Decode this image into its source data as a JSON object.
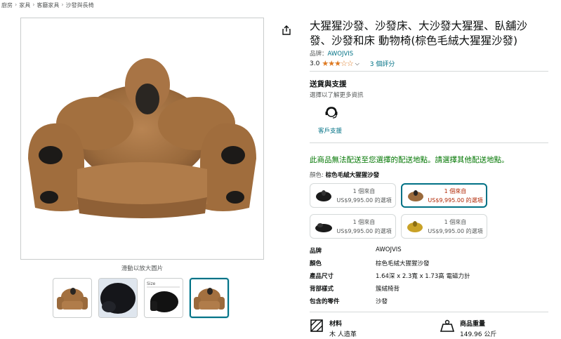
{
  "breadcrumb": [
    "廚房",
    "家具",
    "客廳家具",
    "沙發與長椅"
  ],
  "product": {
    "title": "大猩猩沙發、沙發床、大沙發大猩猩、臥舖沙發、沙發和床 動物椅(棕色毛絨大猩猩沙發)",
    "brand_prefix": "品牌：",
    "brand": "AWOJVIS",
    "rating_value": "3.0",
    "rating": 3.0,
    "rating_max": 5,
    "rating_count": "3 個評分"
  },
  "gallery": {
    "zoom_hint": "滑動以放大圖片",
    "thumbnail_count": 4,
    "thumbnail_size_label": "Size",
    "active_index": 3
  },
  "delivery": {
    "title": "送貨與支援",
    "subtitle": "選擇以了解更多資訊",
    "support_label": "客戶支援",
    "warning": "此商品無法配送至您選擇的配送地點。請選擇其他配送地點。"
  },
  "variant": {
    "label": "顏色:",
    "selected": "棕色毛絨大猩猩沙發",
    "options": [
      {
        "line1": "1 個來自",
        "line2": "US$9,995.00 的選項",
        "selected": false,
        "color": "#1a1a1a"
      },
      {
        "line1": "1 個來自",
        "line2": "US$9,995.00 的選項",
        "selected": true,
        "color": "#9a6a3c"
      },
      {
        "line1": "1 個來自",
        "line2": "US$9,995.00 的選項",
        "selected": false,
        "color": "#1a1a1a"
      },
      {
        "line1": "1 個來自",
        "line2": "US$9,995.00 的選項",
        "selected": false,
        "color": "#c9a227"
      }
    ]
  },
  "specs": [
    {
      "key": "品牌",
      "value": "AWOJVIS"
    },
    {
      "key": "顏色",
      "value": "棕色毛絨大猩猩沙發"
    },
    {
      "key": "產品尺寸",
      "value": "1.64深 x 2.3寬 x 1.73高 電磁力計"
    },
    {
      "key": "背部樣式",
      "value": "簇絨椅背"
    },
    {
      "key": "包含的零件",
      "value": "沙發"
    }
  ],
  "features": [
    {
      "icon": "material-icon",
      "title": "材料",
      "value": "木 人造革"
    },
    {
      "icon": "weight-icon",
      "title": "商品重量",
      "value": "149.96 公斤"
    }
  ],
  "colors": {
    "link": "#007185",
    "star": "#de7921",
    "warning": "#007600",
    "price_red": "#b12704"
  }
}
